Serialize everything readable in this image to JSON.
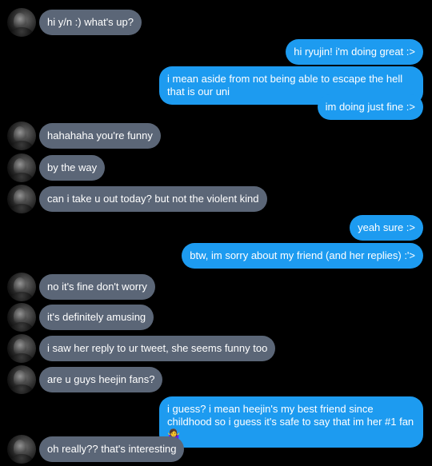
{
  "messages": [
    {
      "side": "in",
      "text": "hi y/n :) what's up?",
      "avatar": "user-avatar"
    },
    {
      "side": "out",
      "text": "hi ryujin! i'm doing great :>"
    },
    {
      "side": "out",
      "text": "i mean aside from not being able to escape the hell that is our uni"
    },
    {
      "side": "out",
      "text": "im doing just fine :>"
    },
    {
      "side": "in",
      "text": "hahahaha you're funny",
      "avatar": "user-avatar"
    },
    {
      "side": "in",
      "text": "by the way",
      "avatar": "user-avatar"
    },
    {
      "side": "in",
      "text": "can i take u out today? but not the violent kind",
      "avatar": "user-avatar"
    },
    {
      "side": "out",
      "text": "yeah sure :>"
    },
    {
      "side": "out",
      "text": "btw, im sorry about my friend (and her replies) :'>"
    },
    {
      "side": "in",
      "text": "no it's fine don't worry",
      "avatar": "user-avatar"
    },
    {
      "side": "in",
      "text": "it's definitely amusing",
      "avatar": "user-avatar"
    },
    {
      "side": "in",
      "text": "i saw her reply to ur tweet, she seems funny too",
      "avatar": "user-avatar"
    },
    {
      "side": "in",
      "text": "are u guys heejin fans?",
      "avatar": "user-avatar"
    },
    {
      "side": "out",
      "text": "i guess? i mean heejin's my best friend since childhood so i guess it's safe to say that im her #1 fan 🤷‍♀️"
    },
    {
      "side": "in",
      "text": "oh really?? that's interesting",
      "avatar": "user-avatar"
    }
  ],
  "colors": {
    "background": "#000000",
    "incoming_bubble": "#5b6677",
    "outgoing_bubble": "#1d9bf0",
    "text": "#ffffff"
  }
}
